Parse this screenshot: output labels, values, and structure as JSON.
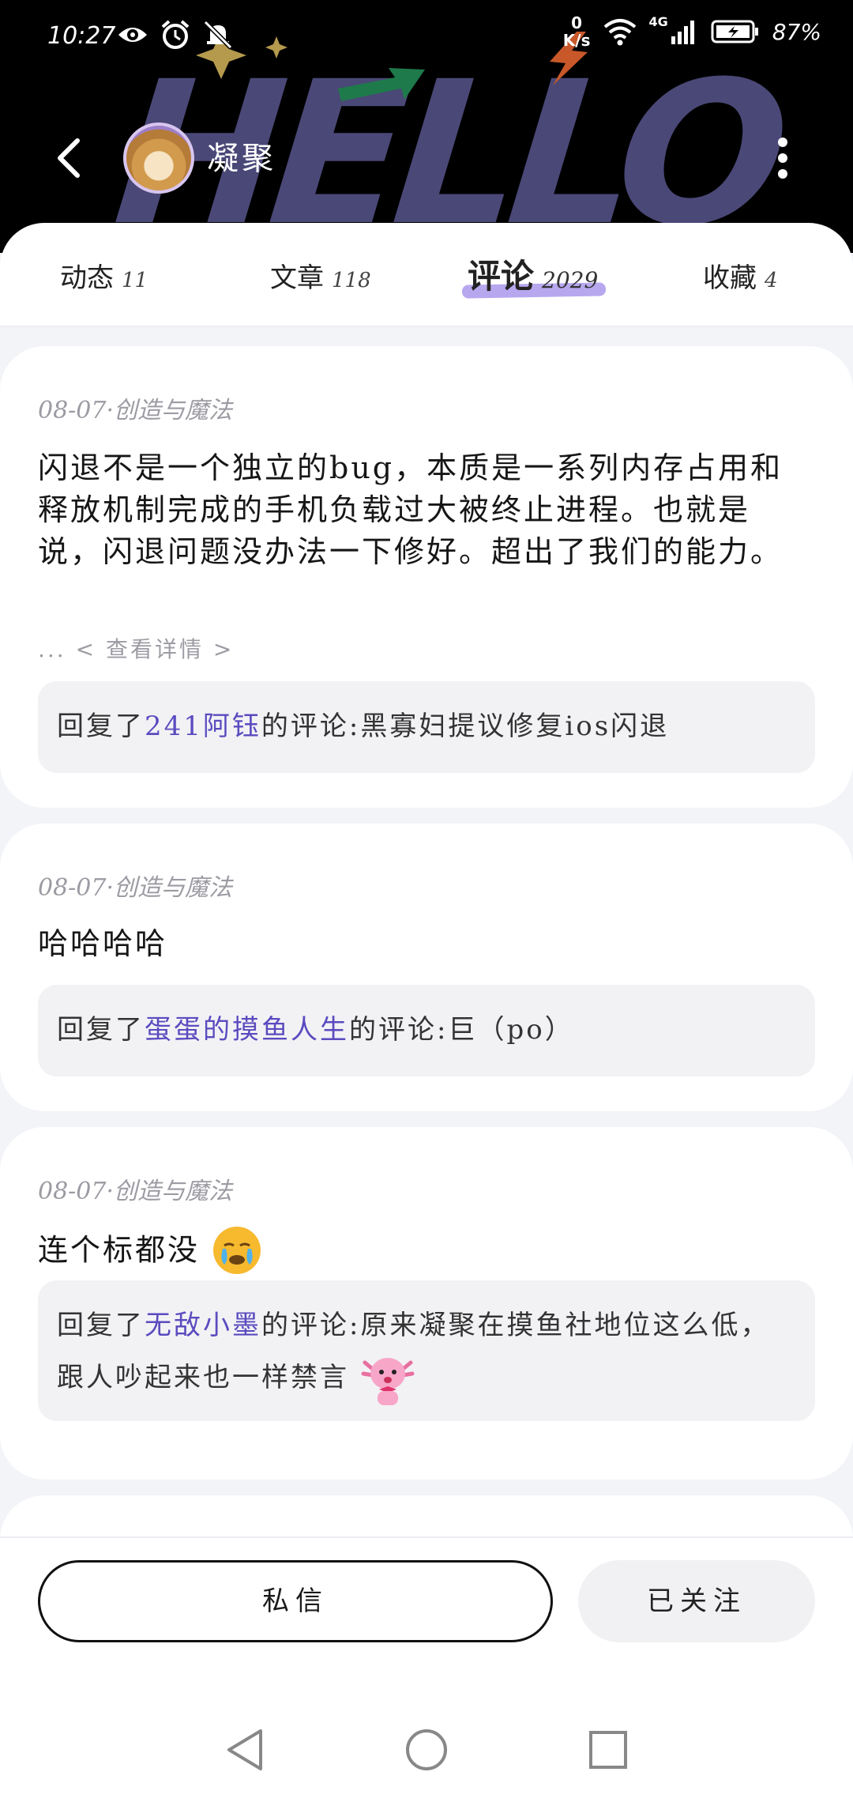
{
  "status_bar": {
    "time": "10:27",
    "net_speed_value": "0",
    "net_speed_unit": "K/s",
    "network_type": "4G",
    "battery": "87%"
  },
  "header": {
    "banner_text": "HELLO",
    "user_name": "凝聚",
    "colors": {
      "background": "#000000",
      "banner_text": "#4a4877",
      "arrow": "#1e7a4a",
      "bolt": "#c8582a",
      "stars": "#b59a4e"
    }
  },
  "tabs": [
    {
      "label": "动态",
      "count": "11",
      "active": false
    },
    {
      "label": "文章",
      "count": "118",
      "active": false
    },
    {
      "label": "评论",
      "count": "2029",
      "active": true
    },
    {
      "label": "收藏",
      "count": "4",
      "active": false
    }
  ],
  "comments": [
    {
      "meta": "08-07·创造与魔法",
      "text": "闪退不是一个独立的bug，本质是一系列内存占用和释放机制完成的手机负载过大被终止进程。也就是说，闪退问题没办法一下修好。超出了我们的能力。",
      "more": "... < 查看详情 >",
      "reply_prefix": "回复了",
      "reply_user": "241阿钰",
      "reply_mid": "的评论:",
      "reply_text": "黑寡妇提议修复ios闪退"
    },
    {
      "meta": "08-07·创造与魔法",
      "text": "哈哈哈哈",
      "reply_prefix": "回复了",
      "reply_user": "蛋蛋的摸鱼人生",
      "reply_mid": "的评论:",
      "reply_text": "巨（po）"
    },
    {
      "meta": "08-07·创造与魔法",
      "text": "连个标都没",
      "text_emoji": "crying-face-emoji",
      "reply_prefix": "回复了",
      "reply_user": "无敌小墨",
      "reply_mid": "的评论:",
      "reply_text": "原来凝聚在摸鱼社地位这么低，跟人吵起来也一样禁言",
      "reply_emoji": "pink-axolotl-sticker"
    }
  ],
  "actions": {
    "message_label": "私信",
    "follow_label": "已关注"
  },
  "accent": {
    "reply_user": "#5a4bbf",
    "tab_underline": "#b7a7ef"
  }
}
